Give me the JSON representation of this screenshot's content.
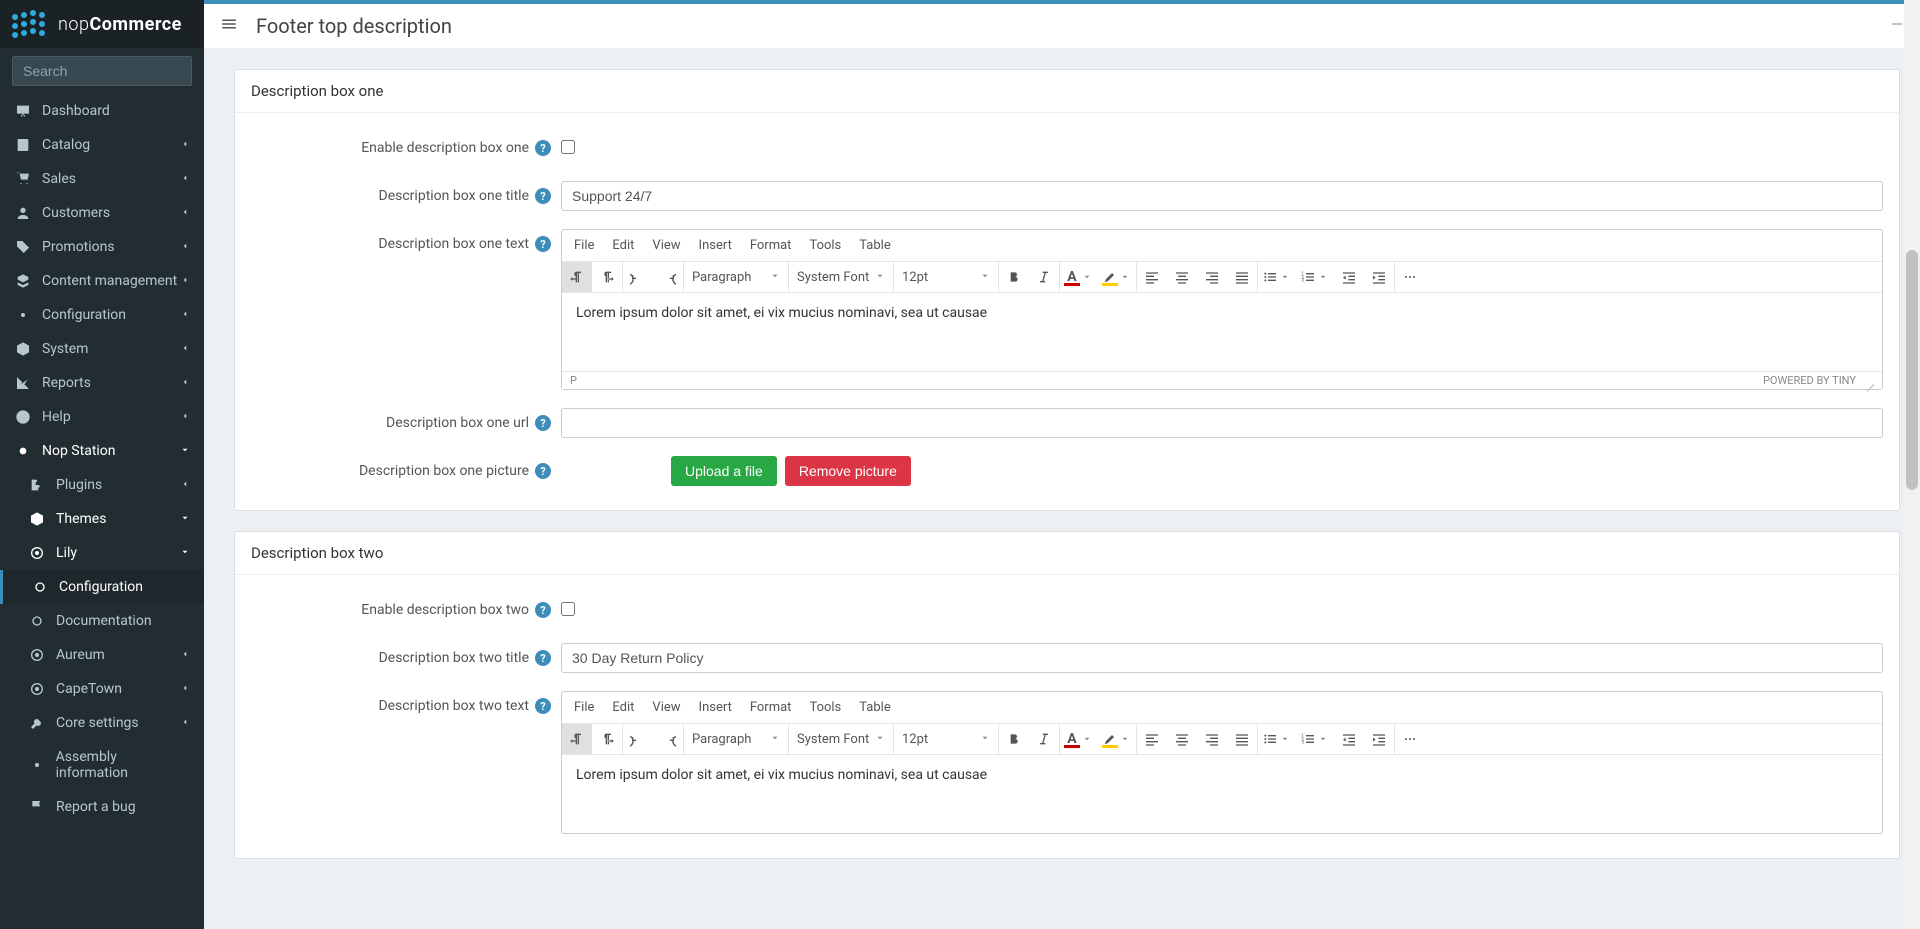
{
  "brand": {
    "name_light": "nop",
    "name_bold": "Commerce"
  },
  "search": {
    "placeholder": "Search"
  },
  "sidebar": {
    "items": [
      {
        "icon": "desktop",
        "label": "Dashboard",
        "caret": false
      },
      {
        "icon": "book",
        "label": "Catalog",
        "caret": true
      },
      {
        "icon": "cart",
        "label": "Sales",
        "caret": true
      },
      {
        "icon": "user",
        "label": "Customers",
        "caret": true
      },
      {
        "icon": "tags",
        "label": "Promotions",
        "caret": true
      },
      {
        "icon": "cubes",
        "label": "Content management",
        "caret": true
      },
      {
        "icon": "gears",
        "label": "Configuration",
        "caret": true
      },
      {
        "icon": "cube",
        "label": "System",
        "caret": true
      },
      {
        "icon": "chart",
        "label": "Reports",
        "caret": true
      },
      {
        "icon": "help",
        "label": "Help",
        "caret": true
      },
      {
        "icon": "dot",
        "label": "Nop Station",
        "caret": true,
        "open": true
      }
    ],
    "sub": [
      {
        "icon": "puzzle",
        "label": "Plugins",
        "caret": true
      },
      {
        "icon": "cube",
        "label": "Themes",
        "caret": true,
        "open": true
      }
    ],
    "sub2": [
      {
        "icon": "target",
        "label": "Lily",
        "caret": true,
        "open": true
      }
    ],
    "sub3": [
      {
        "icon": "circle",
        "label": "Configuration",
        "active": true
      },
      {
        "icon": "circle",
        "label": "Documentation"
      }
    ],
    "sub2b": [
      {
        "icon": "target",
        "label": "Aureum",
        "caret": true
      },
      {
        "icon": "target",
        "label": "CapeTown",
        "caret": true
      }
    ],
    "tail": [
      {
        "icon": "wrench",
        "label": "Core settings",
        "caret": true
      },
      {
        "icon": "gears",
        "label": "Assembly information"
      },
      {
        "icon": "flag",
        "label": "Report a bug"
      }
    ]
  },
  "page": {
    "title": "Footer top description"
  },
  "editor_menu": [
    "File",
    "Edit",
    "View",
    "Insert",
    "Format",
    "Tools",
    "Table"
  ],
  "editor_toolbar": {
    "block": "Paragraph",
    "font": "System Font",
    "size": "12pt"
  },
  "editor_status": {
    "path": "P",
    "powered": "POWERED BY TINY"
  },
  "box1": {
    "header": "Description box one",
    "labels": {
      "enable": "Enable description box one",
      "title": "Description box one title",
      "text": "Description box one text",
      "url": "Description box one url",
      "picture": "Description box one picture"
    },
    "title_value": "Support 24/7",
    "text_value": "Lorem ipsum dolor sit amet, ei vix mucius nominavi, sea ut causae",
    "url_value": "",
    "upload_btn": "Upload a file",
    "remove_btn": "Remove picture"
  },
  "box2": {
    "header": "Description box two",
    "labels": {
      "enable": "Enable description box two",
      "title": "Description box two title",
      "text": "Description box two text"
    },
    "title_value": "30 Day Return Policy",
    "text_value": "Lorem ipsum dolor sit amet, ei vix mucius nominavi, sea ut causae"
  }
}
